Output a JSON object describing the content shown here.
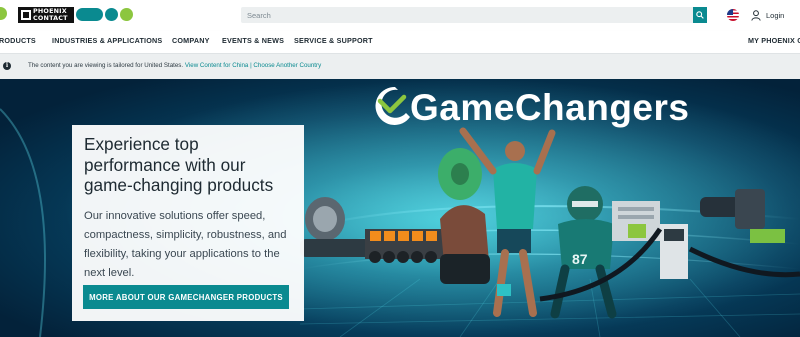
{
  "header": {
    "logo_text_line1": "PHOENIX",
    "logo_text_line2": "CONTACT",
    "brand_colors": {
      "green": "#8cc63f",
      "teal": "#0a8a90",
      "dark": "#111111"
    },
    "search": {
      "placeholder": "Search",
      "icon": "search-icon"
    },
    "flag_icon": "us-flag-icon",
    "login_label": "Login",
    "login_icon": "user-icon"
  },
  "nav": {
    "items": [
      "PRODUCTS",
      "INDUSTRIES & APPLICATIONS",
      "COMPANY",
      "EVENTS & NEWS",
      "SERVICE & SUPPORT"
    ],
    "right_item": "MY PHOENIX CONTACT"
  },
  "info_bar": {
    "icon": "info-icon",
    "text": "The content you are viewing is tailored for United States.",
    "link_china": "View Content for China",
    "separator": " | ",
    "link_country": "Choose Another Country"
  },
  "hero": {
    "brand_title": "GameChangers",
    "heading": "Experience top performance with our game-changing products",
    "body": "Our innovative solutions offer speed, compactness, simplicity, robustness, and flexibility, taking your applications to the next level.",
    "cta_label": "MORE ABOUT OUR GAMECHANGER PRODUCTS",
    "accent_color": "#0a8a90"
  }
}
